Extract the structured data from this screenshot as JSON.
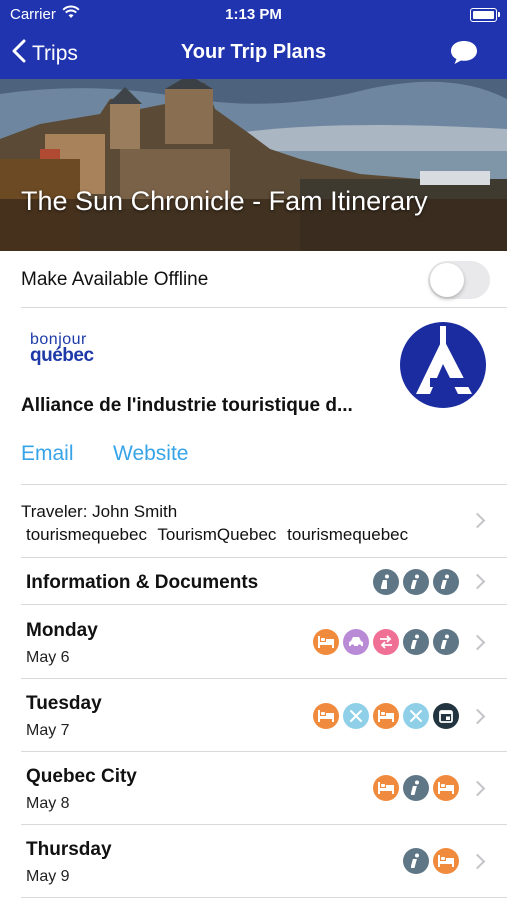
{
  "status_bar": {
    "carrier": "Carrier",
    "time": "1:13 PM"
  },
  "nav": {
    "back_label": "Trips",
    "title": "Your Trip Plans"
  },
  "hero": {
    "title": "The Sun Chronicle - Fam Itinerary"
  },
  "offline": {
    "label": "Make Available Offline",
    "enabled": false
  },
  "organization": {
    "logo_line1": "bonjour",
    "logo_line2": "québec",
    "name": "Alliance de l'industrie touristique d...",
    "email_label": "Email",
    "website_label": "Website"
  },
  "traveler": {
    "line1": "Traveler: John Smith",
    "line2": "tourismequebec  TourismQuebec  tourismequebec"
  },
  "rows": [
    {
      "title": "Information & Documents",
      "subtitle": "",
      "icons": [
        "info-icon",
        "info-icon",
        "info-icon"
      ]
    },
    {
      "title": "Monday",
      "subtitle": "May 6",
      "icons": [
        "bed-icon",
        "car-icon",
        "transfer-icon",
        "info-icon",
        "info-icon"
      ]
    },
    {
      "title": "Tuesday",
      "subtitle": "May 7",
      "icons": [
        "bed-icon",
        "dining-icon",
        "bed-icon",
        "dining-icon",
        "calendar-icon"
      ]
    },
    {
      "title": "Quebec City",
      "subtitle": "May 8",
      "icons": [
        "bed-icon",
        "info-icon",
        "bed-icon"
      ]
    },
    {
      "title": "Thursday",
      "subtitle": "May 9",
      "icons": [
        "info-icon",
        "bed-icon"
      ]
    }
  ],
  "colors": {
    "nav_blue": "#2034b0",
    "link_blue": "#38a4e8",
    "bed_orange": "#f08a3c",
    "car_purple": "#b98ad6",
    "transfer_pink": "#ef6f95",
    "info_gray": "#5f7687",
    "dining_lightblue": "#8fd0e8",
    "calendar_dark": "#22343f"
  }
}
